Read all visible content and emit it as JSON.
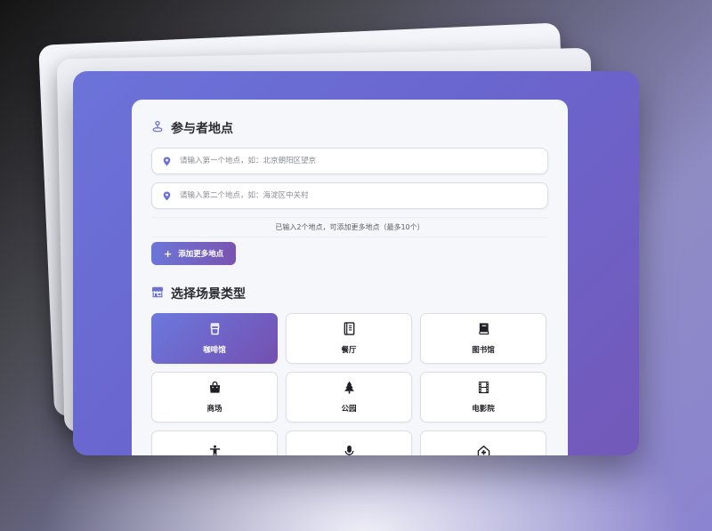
{
  "participants": {
    "title": "参与者地点",
    "icon": "location-person-icon",
    "inputs": [
      {
        "placeholder": "请输入第一个地点，如：北京朝阳区望京",
        "value": "",
        "icon": "map-pin-icon"
      },
      {
        "placeholder": "请输入第二个地点，如：海淀区中关村",
        "value": "",
        "icon": "map-pin-icon"
      }
    ],
    "hint": "已输入2个地点，可添加更多地点（最多10个）",
    "add_button": {
      "icon": "plus-icon",
      "label": "添加更多地点"
    }
  },
  "scenes": {
    "title": "选择场景类型",
    "icon": "store-icon",
    "selected": "咖啡馆",
    "items": [
      {
        "label": "咖啡馆",
        "icon": "coffee-cup-icon",
        "active": true
      },
      {
        "label": "餐厅",
        "icon": "menu-book-icon",
        "active": false
      },
      {
        "label": "图书馆",
        "icon": "book-icon",
        "active": false
      },
      {
        "label": "商场",
        "icon": "shopping-bag-icon",
        "active": false
      },
      {
        "label": "公园",
        "icon": "tree-icon",
        "active": false
      },
      {
        "label": "电影院",
        "icon": "film-icon",
        "active": false
      },
      {
        "label": "",
        "icon": "person-icon",
        "active": false
      },
      {
        "label": "",
        "icon": "microphone-icon",
        "active": false
      },
      {
        "label": "",
        "icon": "hospital-icon",
        "active": false
      }
    ]
  },
  "colors": {
    "accent_start": "#6b78de",
    "accent_end": "#7450b0",
    "pin": "#6a72d6"
  }
}
